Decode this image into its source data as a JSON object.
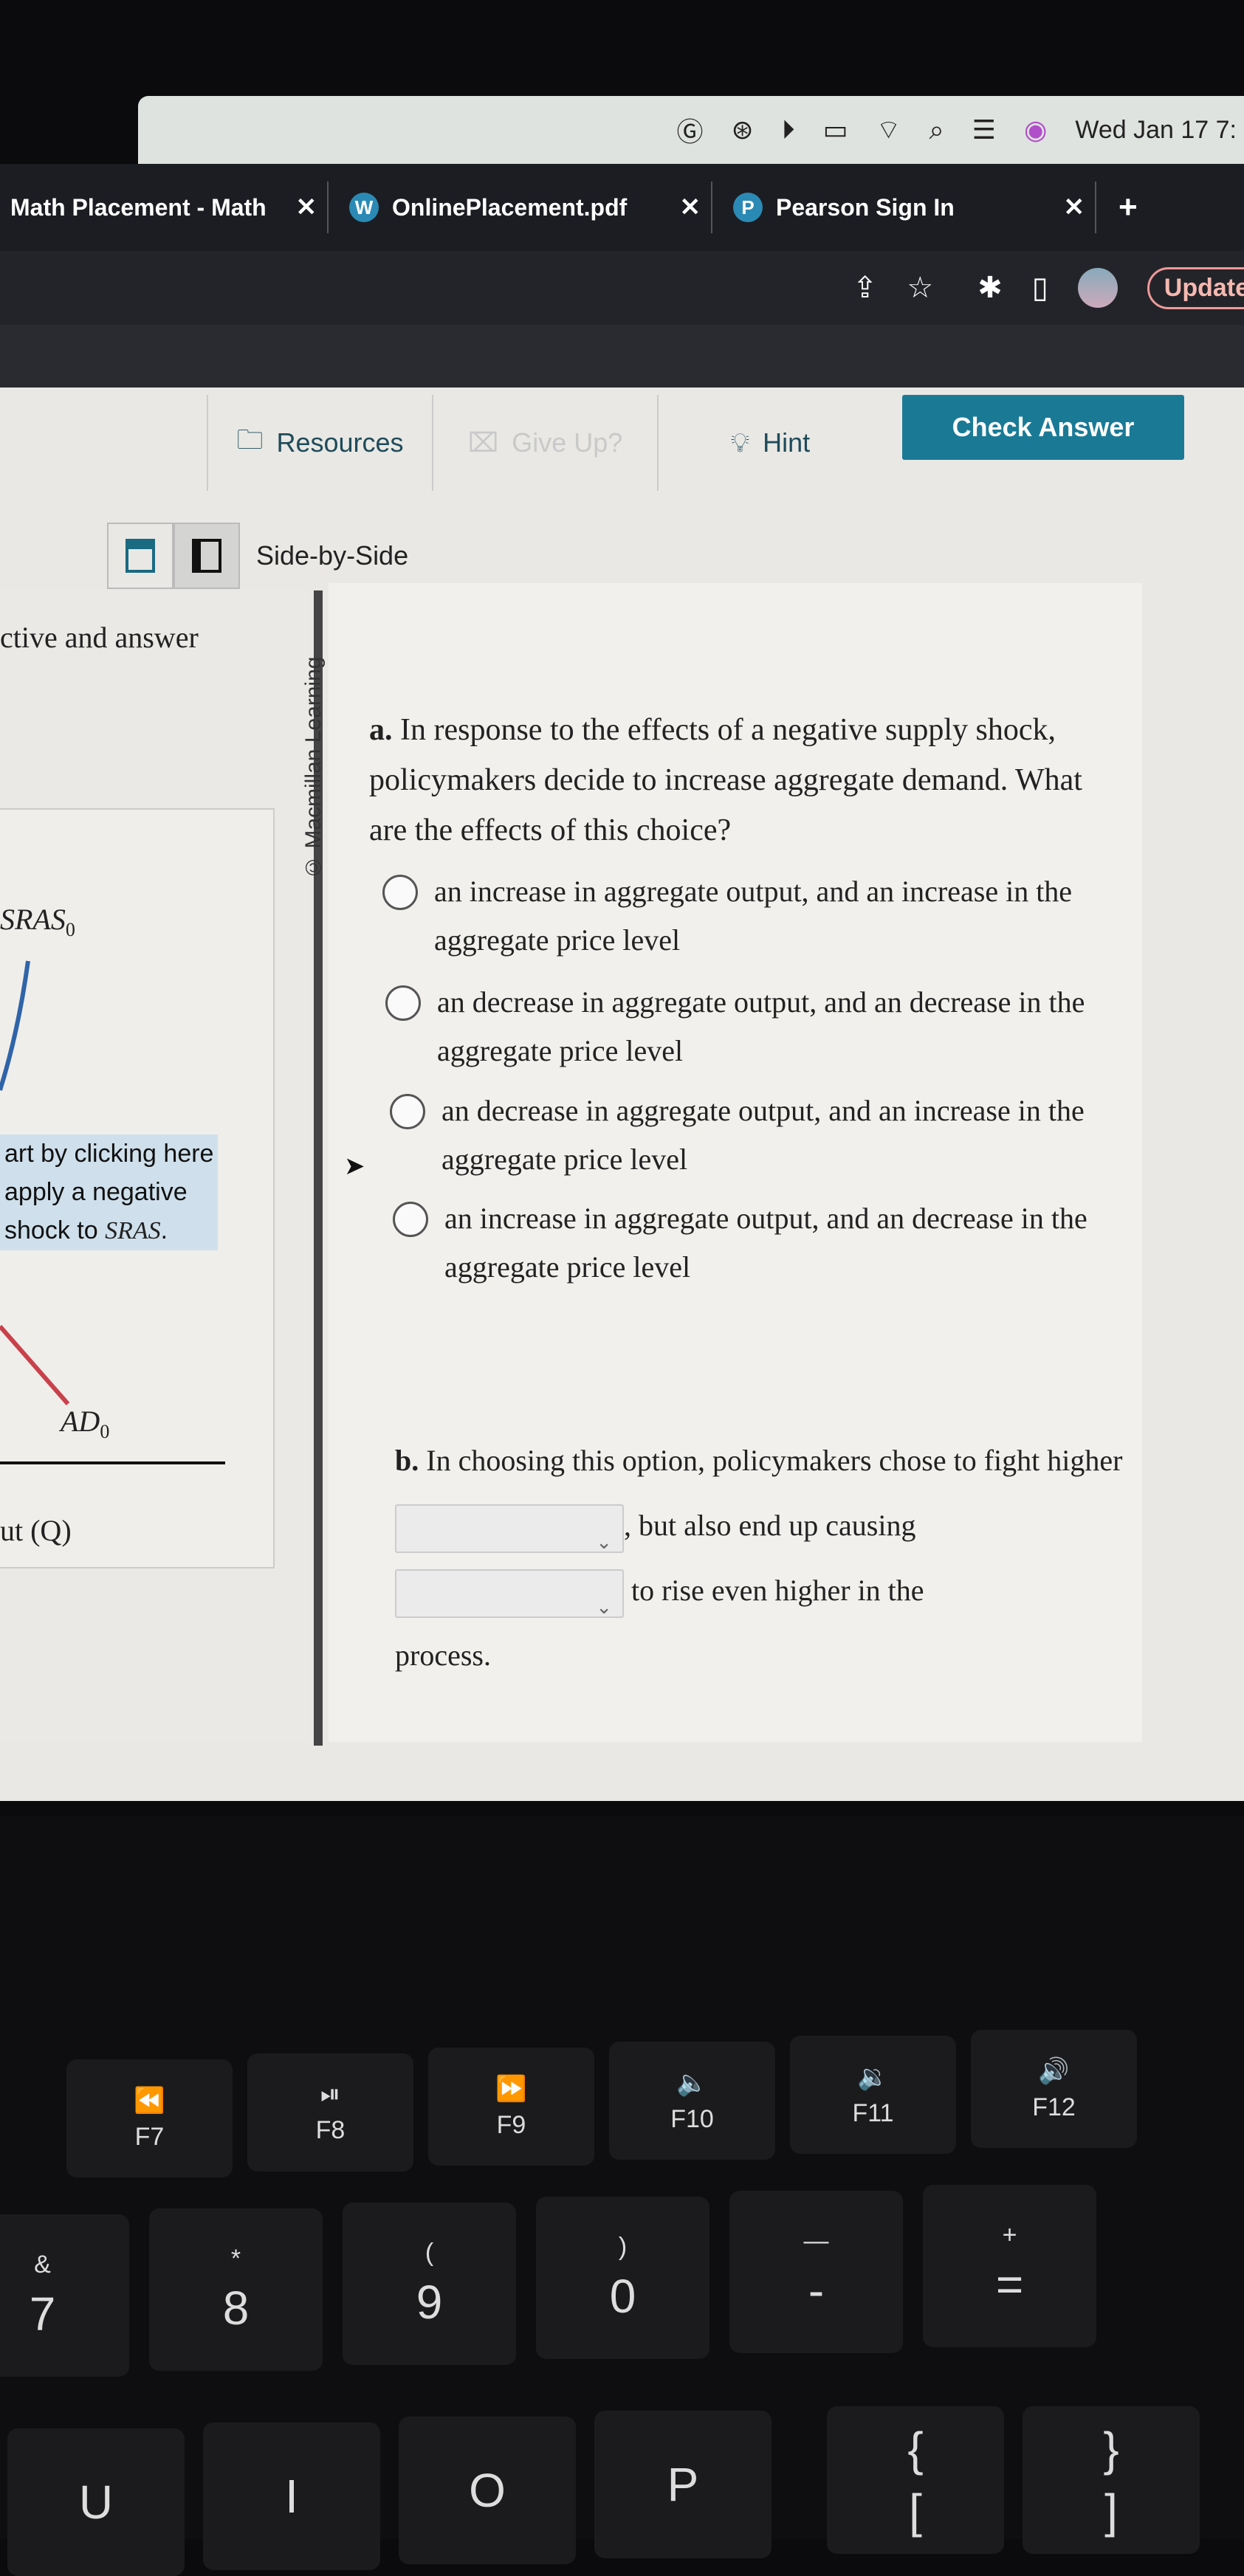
{
  "menubar": {
    "clock": "Wed Jan 17 7:",
    "icons": [
      "grammarly-icon",
      "creative-cloud-icon",
      "play-icon",
      "battery-icon",
      "wifi-icon",
      "search-icon",
      "control-center-icon",
      "siri-icon"
    ]
  },
  "tabs": [
    {
      "label": "Math Placement - Math"
    },
    {
      "label": "OnlinePlacement.pdf"
    },
    {
      "label": "Pearson Sign In"
    }
  ],
  "browser": {
    "update_label": "Update"
  },
  "actions": {
    "resources": "Resources",
    "give_up": "Give Up?",
    "hint": "Hint",
    "check_answer": "Check Answer"
  },
  "view": {
    "label": "Side-by-Side"
  },
  "left": {
    "title": "ctive and answer",
    "sras": "SRAS",
    "sras_sub": "0",
    "instruction_1": "art by clicking here",
    "instruction_2": "apply a negative",
    "instruction_3": "shock to ",
    "instruction_sras": "SRAS",
    "ad": "AD",
    "ad_sub": "0",
    "xaxis": "ut (Q)"
  },
  "copyright": "© Macmillan Learning",
  "question_a": {
    "label": "a.",
    "text": "In response to the effects of a negative supply shock, policymakers decide to increase aggregate demand. What are the effects of this choice?",
    "options": [
      "an increase in aggregate output, and an increase in the aggregate price level",
      "an decrease in aggregate output, and an decrease in the aggregate price level",
      "an decrease in aggregate output, and an increase in the aggregate price level",
      "an increase in aggregate output, and an decrease in the aggregate price level"
    ]
  },
  "question_b": {
    "label": "b.",
    "part1": "In choosing this option, policymakers chose to fight higher",
    "part2": ", but also end up causing",
    "part3": "to rise even higher in the",
    "part4": "process."
  },
  "keyboard": {
    "fkeys": [
      {
        "icon": "rewind-icon",
        "glyph": "⏪",
        "label": "F7"
      },
      {
        "icon": "play-pause-icon",
        "glyph": "⏯",
        "label": "F8"
      },
      {
        "icon": "fast-forward-icon",
        "glyph": "⏩",
        "label": "F9"
      },
      {
        "icon": "mute-icon",
        "glyph": "🔈",
        "label": "F10"
      },
      {
        "icon": "volume-down-icon",
        "glyph": "🔉",
        "label": "F11"
      },
      {
        "icon": "volume-up-icon",
        "glyph": "🔊",
        "label": "F12"
      }
    ],
    "numkeys": [
      [
        "&",
        "7"
      ],
      [
        "*",
        "8"
      ],
      [
        "(",
        "9"
      ],
      [
        ")",
        "0"
      ],
      [
        "—",
        "-"
      ],
      [
        "+",
        "="
      ]
    ],
    "letters": [
      "U",
      "I",
      "O",
      "P"
    ],
    "brackets": [
      [
        "{",
        "["
      ],
      [
        "}",
        "]"
      ]
    ]
  },
  "colors": {
    "accent": "#1a7a96",
    "sras_curve": "#2f64a8",
    "ad_curve": "#c8414b",
    "highlight": "#cfe0ec"
  }
}
